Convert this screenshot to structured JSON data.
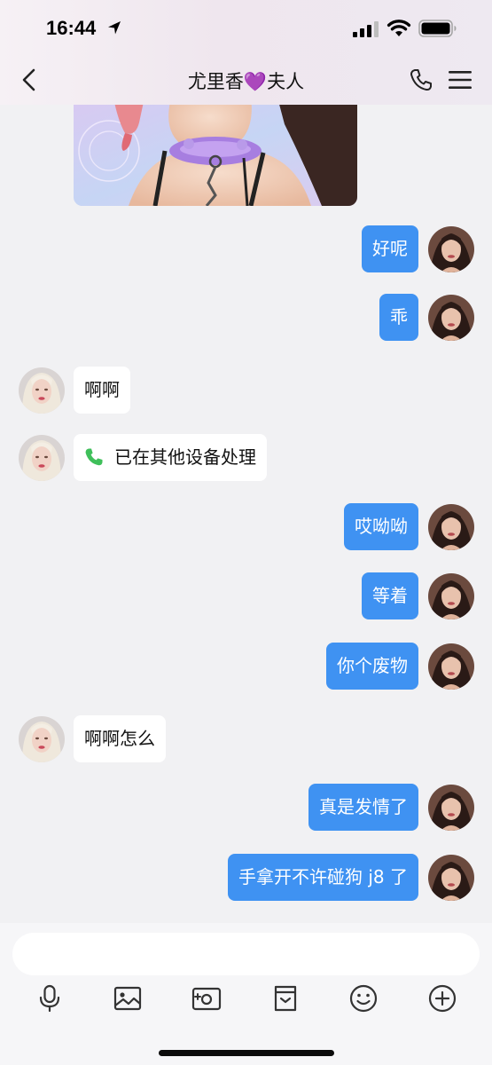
{
  "status_bar": {
    "time": "16:44"
  },
  "nav": {
    "title": "尤里香💜夫人"
  },
  "messages": [
    {
      "side": "out",
      "text": "好呢"
    },
    {
      "side": "out",
      "text": "乖"
    },
    {
      "side": "in",
      "text": "啊啊"
    },
    {
      "side": "in",
      "type": "call",
      "text": "已在其他设备处理"
    },
    {
      "side": "out",
      "text": "哎呦呦"
    },
    {
      "side": "out",
      "text": "等着"
    },
    {
      "side": "out",
      "text": "你个废物"
    },
    {
      "side": "in",
      "text": "啊啊怎么"
    },
    {
      "side": "out",
      "text": "真是发情了"
    },
    {
      "side": "out",
      "text": "手拿开不许碰狗 j8 了"
    }
  ],
  "input": {
    "value": ""
  },
  "toolbar": [
    "mic-icon",
    "image-icon",
    "camera-icon",
    "file-icon",
    "emoji-icon",
    "plus-icon"
  ],
  "colors": {
    "bubble_out": "#3f92f2",
    "bubble_in": "#ffffff",
    "background": "#f1f1f3",
    "call_icon": "#3fbf5a"
  }
}
